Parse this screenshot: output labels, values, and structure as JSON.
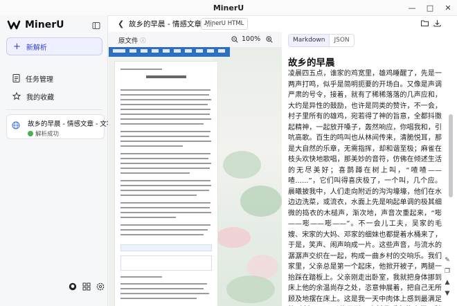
{
  "window": {
    "title": "MinerU",
    "controls": [
      "minimize",
      "maximize",
      "close"
    ]
  },
  "sidebar": {
    "app_name": "MinerU",
    "new_label": "新解析",
    "items": [
      {
        "label": "任务管理",
        "icon": "file-list-icon"
      },
      {
        "label": "我的收藏",
        "icon": "star-icon"
      }
    ],
    "task": {
      "name": "故乡的早晨 - 情感文章 - 文字站",
      "status": "解析成功"
    },
    "footer_icons": [
      "github-icon",
      "apps-icon",
      "settings-icon"
    ]
  },
  "header": {
    "title": "故乡的早晨 - 情感文章 -...",
    "chip": "MinerU HTML",
    "right_icons": [
      "folder-icon",
      "download-icon"
    ]
  },
  "left": {
    "label": "原文件",
    "zoom": "100%"
  },
  "right": {
    "tabs": [
      {
        "label": "Markdown",
        "active": true
      },
      {
        "label": "JSON",
        "active": false
      }
    ],
    "article_title": "故乡的早晨",
    "article_body": "凌晨四五点，谁家的鸡宽里，雄鸡睡醒了，先是一两声打鸣，似乎是简明扼要的开场白。又像是声调严肃的号令，接着，就有了稀稀落落的几声应和，大约是异性的鼓励，也许是同类的赞许，不一会，村子里所有的雄鸡，宛若得了神的旨意，全都抖擞起精神，一起放开嗓子，轰然响应，你唱我和，引吭高歌。百生的鸣叫也从林间传来，清脆悦耳，那是大自然的乐章，无需指挥，却和谐至极；麻雀在枝头欢快地歌唱，那美妙的音符，仿佛在倾述生活的无尽美好；喜鹊蹲在树上叫，“喳喳——喳......”，它们叫得喜庆极了，一个叫，几个应。晨曦披我中，人们走向附近的沟沟壕壕，他们在水边边洗菜，或流衣，水面上先是响起单调的极其细微的捣衣的木槌声，渐次地，声音次重起来，“嘭——嘭——嘭——”。不一会儿工夫，吴家的毛嫂、宋家的大妈、邓家的细妹也都提着水桶来了，于是，笑声、闹声响成一片。这些声音，与流水的潺潺声交织在一起，构成一曲乡村的交响乐。我们家里，父亲总是第一个起床，他掀开被子，两腿一抬踩在踏板上。父亲刚走出卧室，我就把身体挪到床上他的余温尚存之处，恣意伸展着，把自己无所顾及地摆在床上。这是我一天中肉体上感到最满足的时刻——可以伸展到一个新且暖和的空间。随后，父亲轻轻地问我：“九满，今天要背书吗？”背啊！当然要背！于是，我如装了弹簧般，一个鲤鱼打挺从床上跃起，三下五除二地穿好衣服。翻出语文课本，迈着八字步，慢悠悠地走动，像古时候的书院山长。父亲一穿好衣服，就挑着水桶走向村中央的抗旱沟，身上被着如水的月光，肩上的扁担颤颤悠悠，两只水桶起起落落，有节奏地发出“吱吱呀呀”的声响。"
  }
}
